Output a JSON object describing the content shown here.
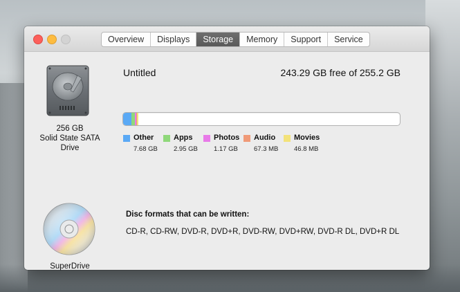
{
  "window": {
    "tabs": [
      {
        "label": "Overview",
        "active": false
      },
      {
        "label": "Displays",
        "active": false
      },
      {
        "label": "Storage",
        "active": true
      },
      {
        "label": "Memory",
        "active": false
      },
      {
        "label": "Support",
        "active": false
      },
      {
        "label": "Service",
        "active": false
      }
    ]
  },
  "drive": {
    "icon": "hard-drive-icon",
    "capacity": "256 GB",
    "type_line1": "Solid State SATA",
    "type_line2": "Drive",
    "volume_name": "Untitled",
    "free_text": "243.29 GB free of 255.2 GB",
    "usage_segments": [
      {
        "name": "Other",
        "size": "7.68 GB",
        "color": "#5aa9f5",
        "fraction": 0.0301
      },
      {
        "name": "Apps",
        "size": "2.95 GB",
        "color": "#8fd87a",
        "fraction": 0.0116
      },
      {
        "name": "Photos",
        "size": "1.17 GB",
        "color": "#e87ae8",
        "fraction": 0.0046
      },
      {
        "name": "Audio",
        "size": "67.3 MB",
        "color": "#f09a78",
        "fraction": 0.0003
      },
      {
        "name": "Movies",
        "size": "46.8 MB",
        "color": "#f3e27a",
        "fraction": 0.0002
      }
    ]
  },
  "superdrive": {
    "icon": "optical-disc-icon",
    "name": "SuperDrive",
    "formats_heading": "Disc formats that can be written:",
    "formats": "CD-R, CD-RW, DVD-R, DVD+R, DVD-RW, DVD+RW, DVD-R DL, DVD+R DL"
  }
}
